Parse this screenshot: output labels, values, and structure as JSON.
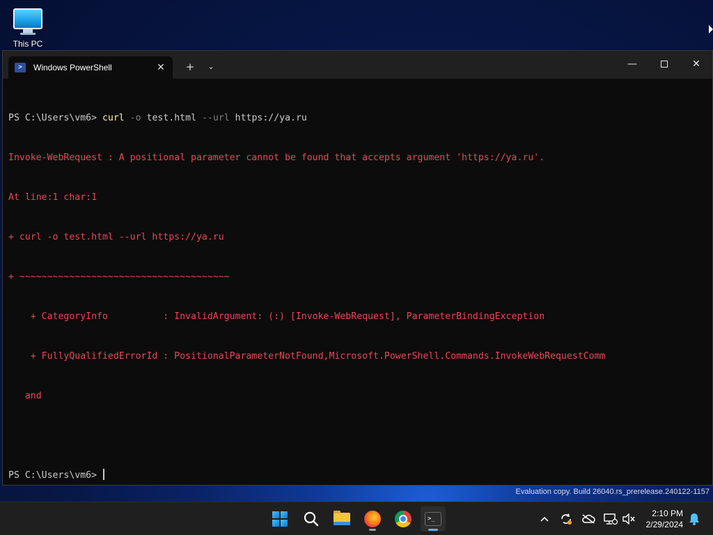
{
  "desktop": {
    "icons": [
      {
        "label": "This PC",
        "icon": "monitor-icon"
      }
    ]
  },
  "window": {
    "tab_title": "Windows PowerShell",
    "tab_icon": "powershell-icon",
    "new_tab_glyph": "+",
    "dropdown_glyph": "⌄",
    "close_tab_glyph": "✕",
    "minimize_glyph": "—",
    "close_glyph": "✕"
  },
  "terminal": {
    "prompt": "PS C:\\Users\\vm6> ",
    "command": {
      "name": "curl",
      "param1": "-o",
      "arg1": "test.html",
      "param2": "--url",
      "arg2": "https://ya.ru"
    },
    "error_lines": [
      "Invoke-WebRequest : A positional parameter cannot be found that accepts argument 'https://ya.ru'.",
      "At line:1 char:1",
      "+ curl -o test.html --url https://ya.ru",
      "+ ~~~~~~~~~~~~~~~~~~~~~~~~~~~~~~~~~~~~~~",
      "    + CategoryInfo          : InvalidArgument: (:) [Invoke-WebRequest], ParameterBindingException",
      "    + FullyQualifiedErrorId : PositionalParameterNotFound,Microsoft.PowerShell.Commands.InvokeWebRequestComm",
      "   and"
    ],
    "second_prompt": "PS C:\\Users\\vm6> "
  },
  "watermark": "Evaluation copy. Build 26040.rs_prerelease.240122-1157",
  "taskbar": {
    "apps": [
      {
        "name": "start",
        "icon": "windows-start-icon"
      },
      {
        "name": "search",
        "icon": "search-icon"
      },
      {
        "name": "file-explorer",
        "icon": "folder-icon"
      },
      {
        "name": "firefox",
        "icon": "firefox-icon"
      },
      {
        "name": "chrome",
        "icon": "chrome-icon"
      },
      {
        "name": "terminal",
        "icon": "terminal-icon",
        "active": true
      }
    ],
    "tray": {
      "chevron_glyph": "^",
      "time": "2:10 PM",
      "date": "2/29/2024"
    }
  }
}
